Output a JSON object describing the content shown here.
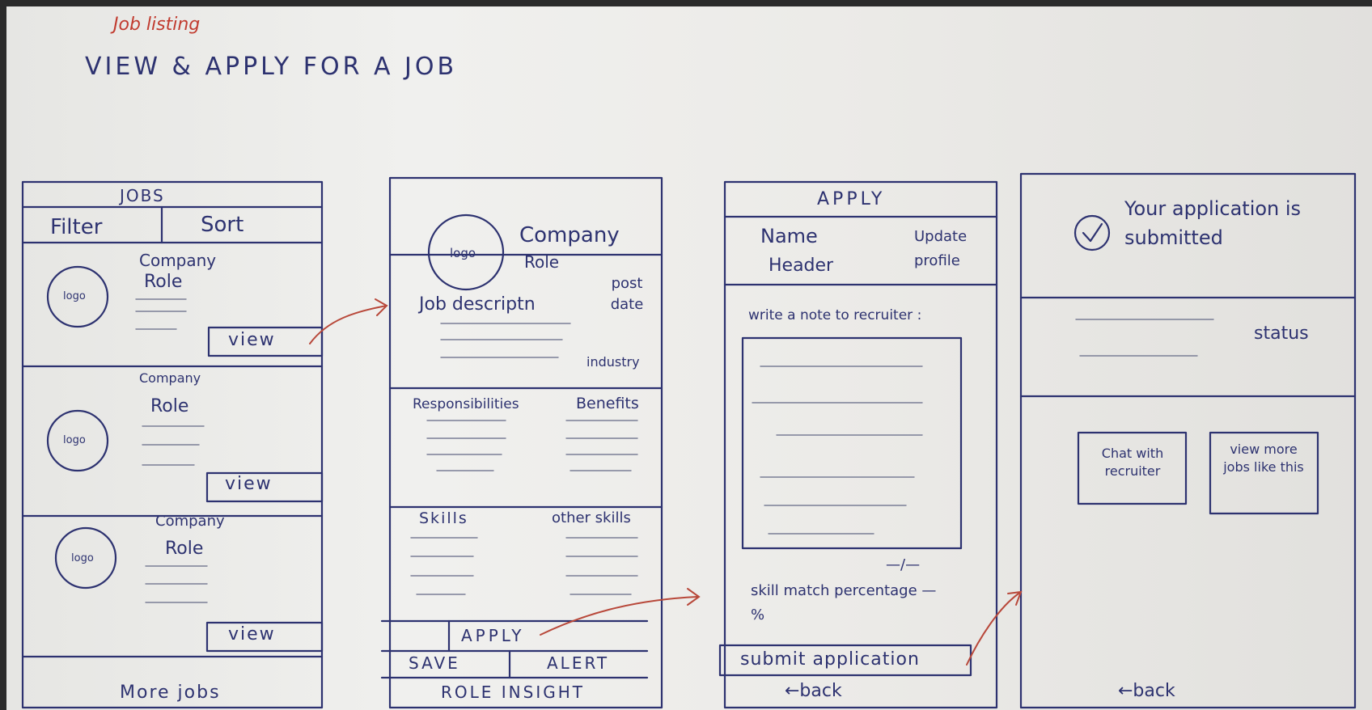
{
  "header": {
    "tag": "Job listing",
    "title": "VIEW & APPLY FOR A JOB"
  },
  "screen1": {
    "title": "JOBS",
    "filter_label": "Filter",
    "sort_label": "Sort",
    "cards": [
      {
        "logo": "logo",
        "company": "Company",
        "role": "Role",
        "view_label": "view"
      },
      {
        "logo": "logo",
        "company": "Company",
        "role": "Role",
        "view_label": "view"
      },
      {
        "logo": "logo",
        "company": "Company",
        "role": "Role",
        "view_label": "view"
      }
    ],
    "more_jobs": "More jobs"
  },
  "screen2": {
    "logo": "logo",
    "company": "Company",
    "role": "Role",
    "job_description": "Job descriptn",
    "post_date": "post date",
    "industry": "industry",
    "responsibilities": "Responsibilities",
    "benefits": "Benefits",
    "skills": "Skills",
    "other_skills": "other skills",
    "apply_label": "APPLY",
    "save_label": "SAVE",
    "alert_label": "ALERT",
    "role_insight_label": "ROLE INSIGHT"
  },
  "screen3": {
    "title": "APPLY",
    "name": "Name",
    "header": "Header",
    "update_profile": "Update profile",
    "note_label": "write a note to recruiter :",
    "char_count": "—/—",
    "skill_match": "skill match percentage —%",
    "submit_label": "submit application",
    "back_label": "←back"
  },
  "screen4": {
    "confirmation": "Your application is submitted",
    "status": "status",
    "chat_label": "Chat with recruiter",
    "view_more_label": "view more jobs like this",
    "back_label": "←back"
  }
}
